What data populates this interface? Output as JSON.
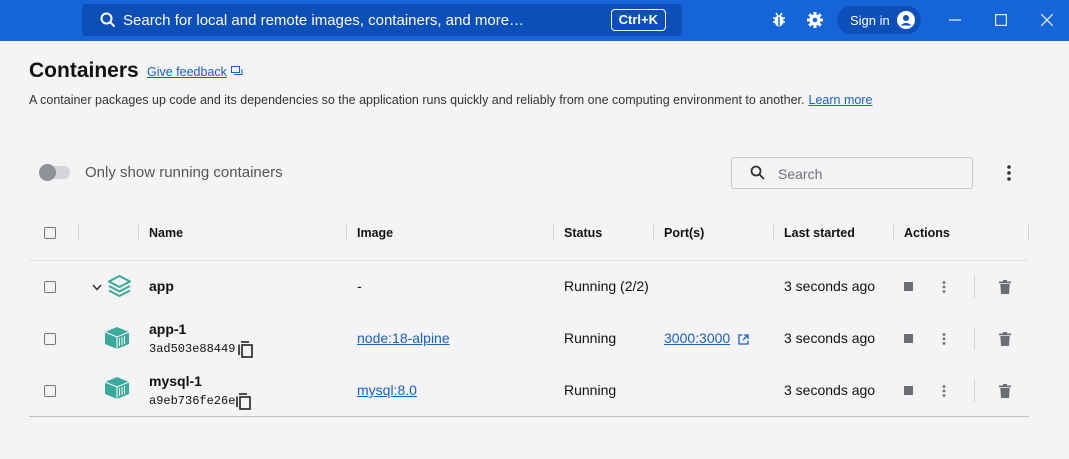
{
  "topbar": {
    "search_placeholder": "Search for local and remote images, containers, and more…",
    "shortcut": "Ctrl+K",
    "signin_label": "Sign in"
  },
  "header": {
    "title": "Containers",
    "feedback_label": "Give feedback",
    "description": "A container packages up code and its dependencies so the application runs quickly and reliably from one computing environment to another.",
    "learn_more": "Learn more"
  },
  "toolbar": {
    "toggle_label": "Only show running containers",
    "toggle_on": false,
    "search_placeholder": "Search"
  },
  "table": {
    "columns": [
      "Name",
      "Image",
      "Status",
      "Port(s)",
      "Last started",
      "Actions"
    ],
    "rows": [
      {
        "name": "app",
        "id": "",
        "image": "-",
        "status": "Running (2/2)",
        "ports": "",
        "last_started": "3 seconds ago",
        "type": "stack-icon"
      },
      {
        "name": "app-1",
        "id": "3ad503e88449",
        "image": "node:18-alpine",
        "status": "Running",
        "ports": "3000:3000",
        "last_started": "3 seconds ago",
        "type": "container-icon"
      },
      {
        "name": "mysql-1",
        "id": "a9eb736fe26e",
        "image": "mysql:8.0",
        "status": "Running",
        "ports": "",
        "last_started": "3 seconds ago",
        "type": "container-icon"
      }
    ]
  },
  "colors": {
    "topbar": "#1565d8",
    "link": "#1a5fc4",
    "container_icon": "#3ba99c"
  }
}
